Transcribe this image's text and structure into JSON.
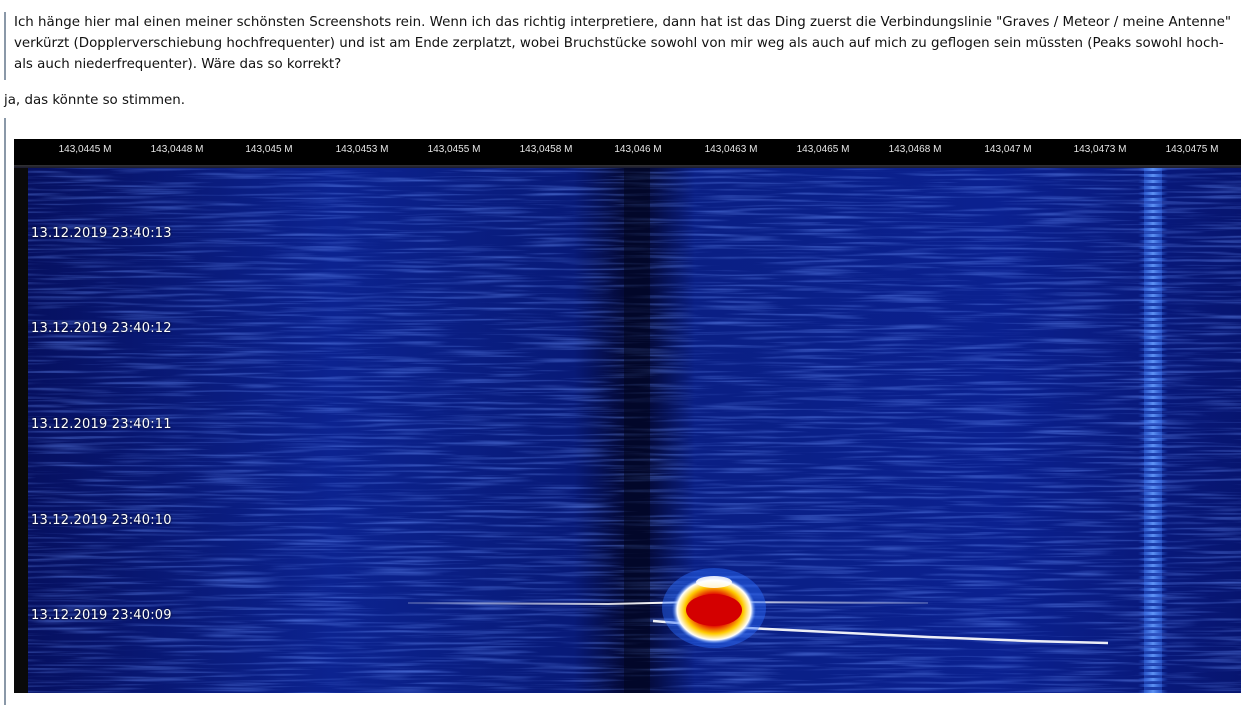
{
  "post": {
    "quote_text": "Ich hänge hier mal einen meiner schönsten Screenshots rein. Wenn ich das richtig interpretiere, dann hat ist das Ding zuerst die Verbindungslinie \"Graves / Meteor / meine Antenne\" verkürzt (Dopplerverschiebung hochfrequenter) und ist am Ende zerplatzt, wobei Bruchstücke sowohl von mir weg als auch auf mich zu geflogen sein müssten (Peaks sowohl hoch- als auch niederfrequenter). Wäre das so korrekt?",
    "reply_text": "ja, das könnte so stimmen."
  },
  "screenshot": {
    "frequency_labels": [
      "143,0445 M",
      "143,0448 M",
      "143,045 M",
      "143,0453 M",
      "143,0455 M",
      "143,0458 M",
      "143,046 M",
      "143,0463 M",
      "143,0465 M",
      "143,0468 M",
      "143,047 M",
      "143,0473 M",
      "143,0475 M"
    ],
    "time_labels": [
      "13.12.2019 23:40:13",
      "13.12.2019 23:40:12",
      "13.12.2019 23:40:11",
      "13.12.2019 23:40:10",
      "13.12.2019 23:40:09"
    ],
    "colors": {
      "background_deep": "#04083a",
      "background_mid": "#0b1f8c",
      "signal_hot": "#d40000",
      "signal_warm": "#ffd400",
      "trace": "#ffffff"
    }
  }
}
